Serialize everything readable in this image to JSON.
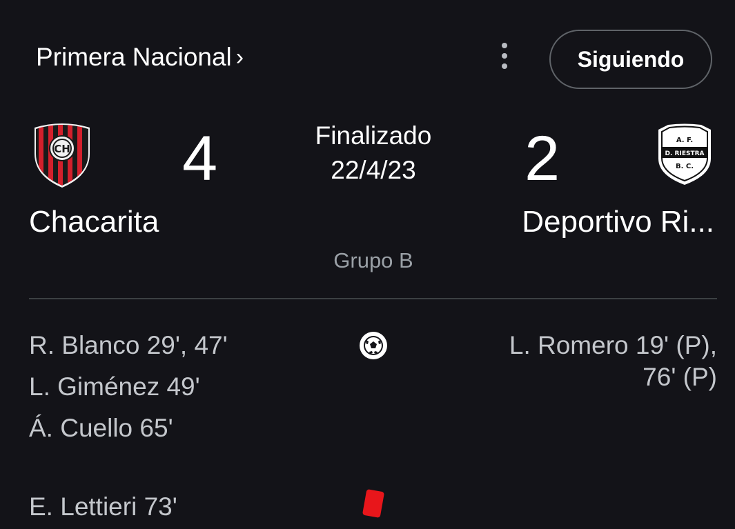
{
  "header": {
    "competition": "Primera Nacional",
    "competition_chevron": "›",
    "follow_label": "Siguiendo"
  },
  "match": {
    "status": "Finalizado",
    "date": "22/4/23",
    "group": "Grupo B",
    "home": {
      "name": "Chacarita",
      "score": "4",
      "crest_text": "CH"
    },
    "away": {
      "name": "Deportivo Ri...",
      "score": "2",
      "crest_top": "A.   F.",
      "crest_middle": "D. RIESTRA",
      "crest_bottom": "B.   C."
    }
  },
  "events": {
    "goals_icon": "soccer-ball-icon",
    "home_goals": [
      "R. Blanco 29', 47'",
      "L. Giménez 49'",
      "Á. Cuello 65'"
    ],
    "away_goals": [
      "L. Romero 19' (P),",
      "76' (P)"
    ],
    "red_cards_icon": "red-card-icon",
    "home_red_cards": [
      "E. Lettieri 73'"
    ]
  },
  "colors": {
    "background": "#131318",
    "divider": "#3c4043",
    "red_card": "#e8161b",
    "home_crest_red": "#d3202c"
  }
}
